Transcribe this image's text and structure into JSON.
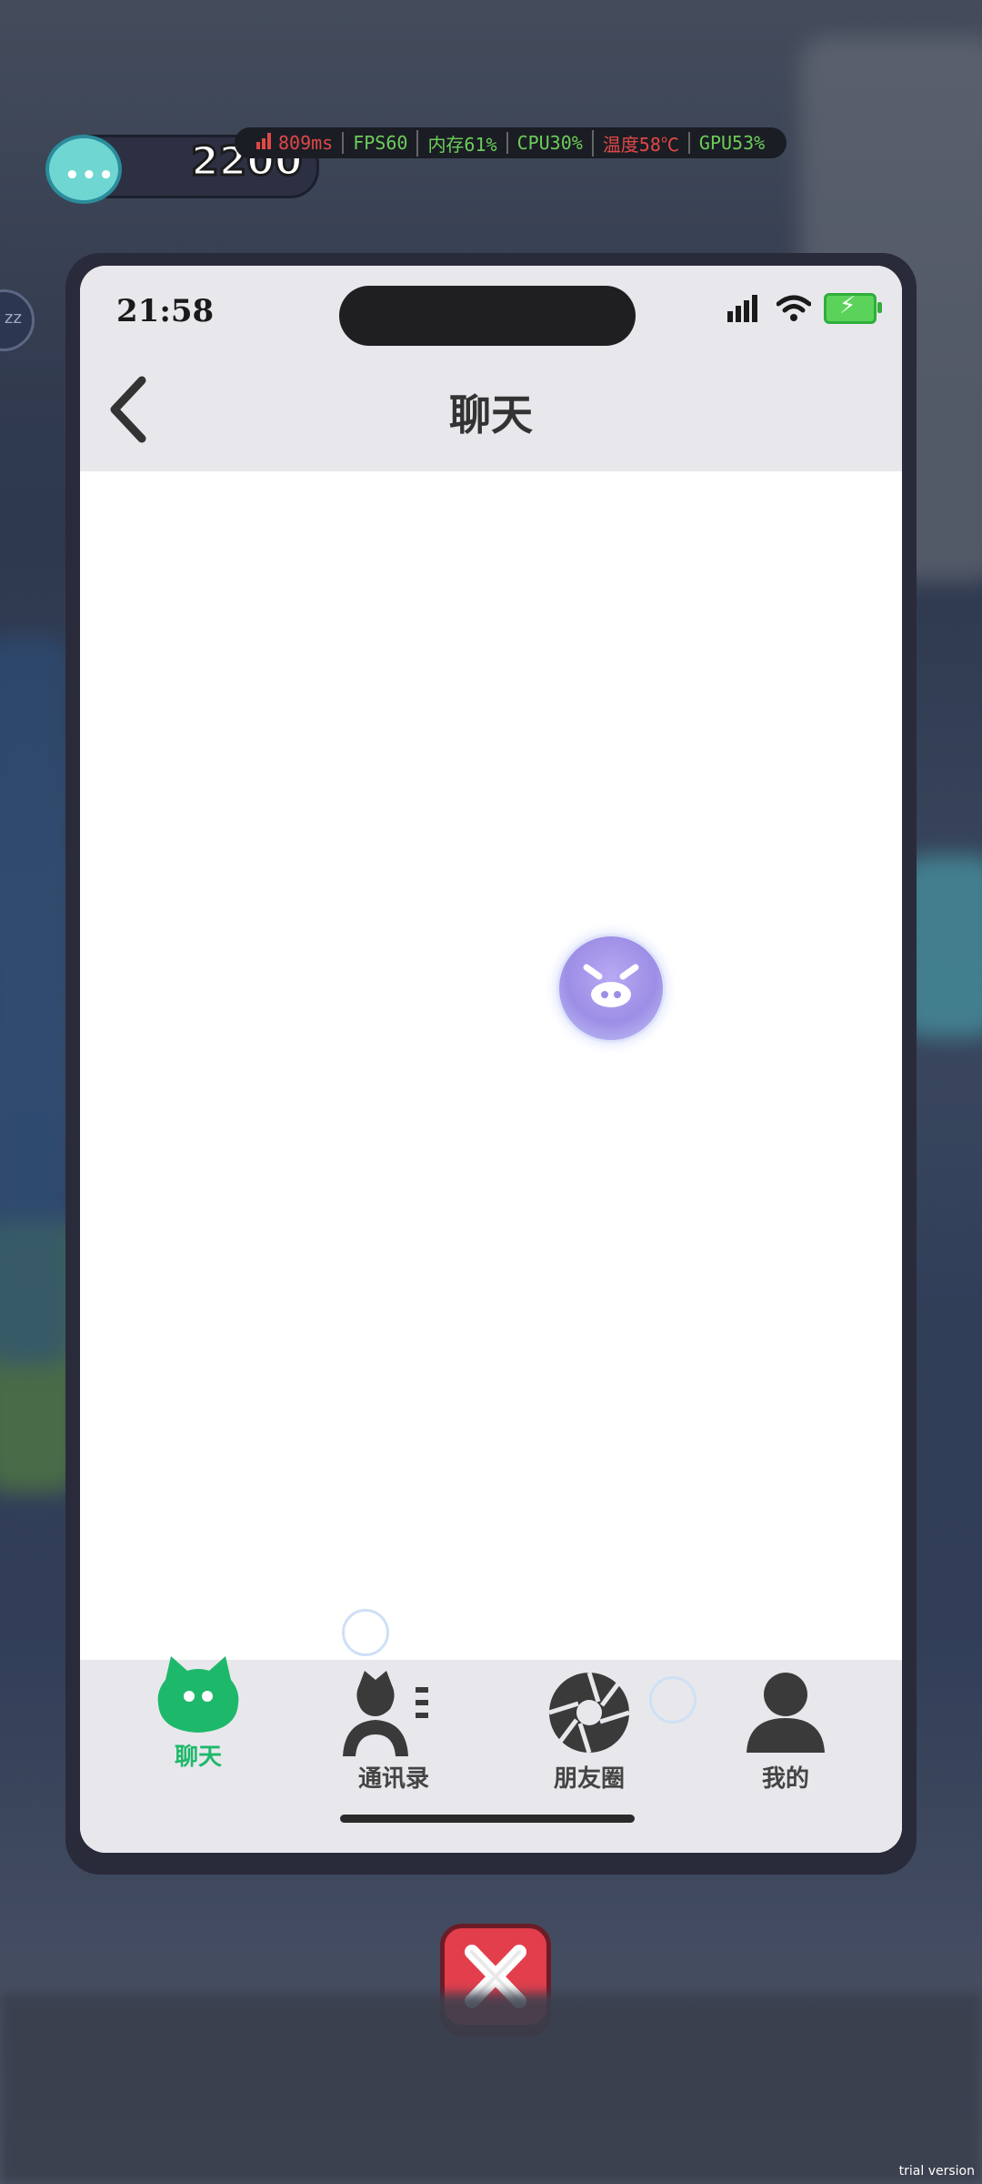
{
  "hud": {
    "coins": "2200",
    "perf": {
      "ping": "809ms",
      "fps": "FPS60",
      "memory": "内存61%",
      "cpu": "CPU30%",
      "temp": "温度58℃",
      "gpu": "GPU53%"
    }
  },
  "status_bar": {
    "time": "21:58"
  },
  "header": {
    "title": "聊天"
  },
  "tabs": [
    {
      "label": "聊天",
      "icon": "chat-cat-icon",
      "active": true
    },
    {
      "label": "通讯录",
      "icon": "contacts-icon",
      "active": false
    },
    {
      "label": "朋友圈",
      "icon": "moments-aperture-icon",
      "active": false
    },
    {
      "label": "我的",
      "icon": "profile-icon",
      "active": false
    }
  ],
  "colors": {
    "active_tab": "#1eb86b",
    "inactive_tab": "#444444",
    "close_button": "#e33e4c",
    "header_bg": "#e8e8ec"
  },
  "watermark": "trial version"
}
